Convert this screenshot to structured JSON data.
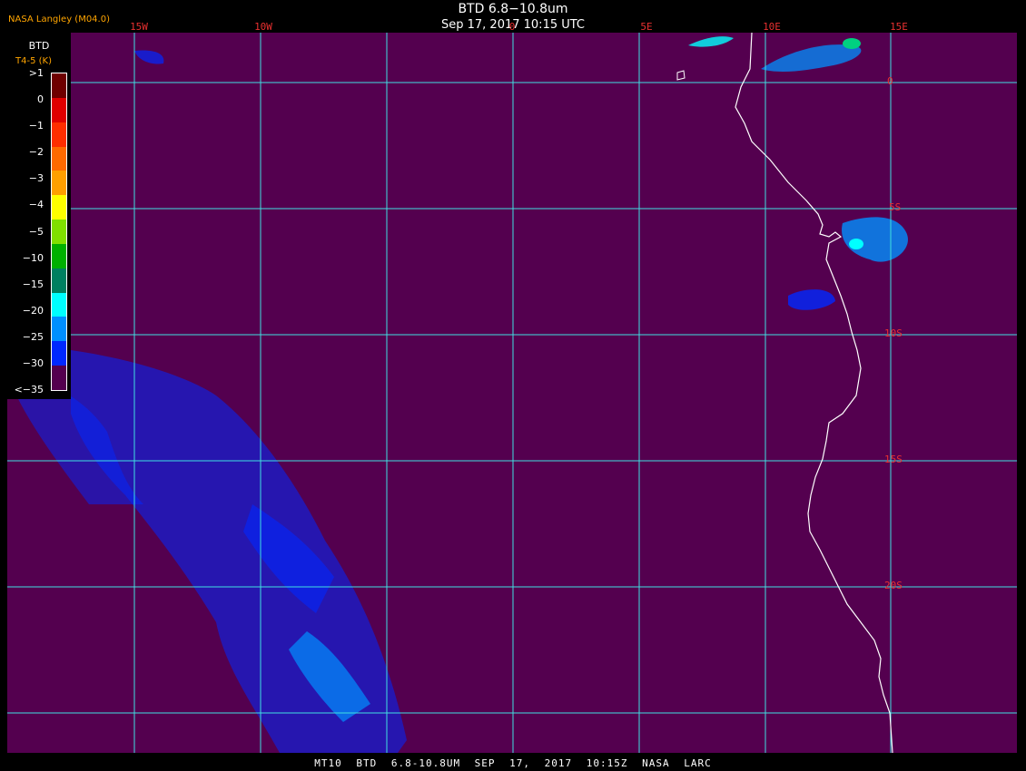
{
  "header": {
    "title": "BTD 6.8−10.8um",
    "time": "Sep 17, 2017 10:15 UTC",
    "org": "NASA Langley (M04.0)"
  },
  "footer": {
    "text": "MT10  BTD 6.8-10.8UM  SEP 17, 2017 10:15Z  NASA LARC"
  },
  "legend": {
    "title": "BTD",
    "unit": "T4-5 (K)",
    "labels": [
      ">1",
      "0",
      "−1",
      "−2",
      "−3",
      "−4",
      "−5",
      "−10",
      "−15",
      "−20",
      "−25",
      "−30",
      "<−35"
    ],
    "colors": [
      "#6e0000",
      "#e00000",
      "#ff2e00",
      "#ff6a00",
      "#ffa000",
      "#ffff00",
      "#80e000",
      "#00b000",
      "#008060",
      "#00ffff",
      "#0090ff",
      "#0028ff",
      "#54004f"
    ]
  },
  "grid": {
    "longitudes": [
      "15W",
      "10W",
      "0",
      "5E",
      "10E",
      "15E"
    ],
    "latitudes": [
      "0",
      "5S",
      "10S",
      "15S",
      "20S"
    ]
  },
  "colors": {
    "background": "#54004f",
    "grid": "#40e0e0",
    "coast": "#ffffff",
    "label": "#e83030",
    "cloud": "#0028ff"
  }
}
